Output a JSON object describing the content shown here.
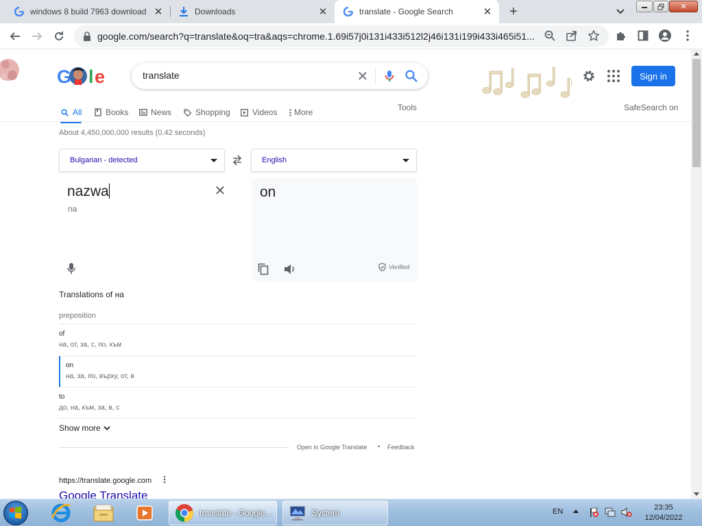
{
  "browser": {
    "tabs": [
      {
        "title": "windows 8 build 7963 download",
        "active": false
      },
      {
        "title": "Downloads",
        "active": false
      },
      {
        "title": "translate - Google Search",
        "active": true
      }
    ],
    "new_tab": "+",
    "url": "google.com/search?q=translate&oq=tra&aqs=chrome.1.69i57j0i131i433i512l2j46i131i199i433i465i51..."
  },
  "google": {
    "query": "translate",
    "sign_in": "Sign in",
    "tabs": [
      {
        "label": "All",
        "icon": "search-icon"
      },
      {
        "label": "Books",
        "icon": "book-icon"
      },
      {
        "label": "News",
        "icon": "news-icon"
      },
      {
        "label": "Shopping",
        "icon": "tag-icon"
      },
      {
        "label": "Videos",
        "icon": "play-icon"
      },
      {
        "label": "More",
        "icon": "more-vert-icon"
      }
    ],
    "tools": "Tools",
    "safesearch": "SafeSearch on",
    "results_count": "About 4,450,000,000 results (0.42 seconds)"
  },
  "translate": {
    "source_lang": "Bulgarian - detected",
    "target_lang": "English",
    "source_text": "nazwa",
    "source_translit": "na",
    "target_text": "on",
    "verified": "Verified",
    "translations_heading": "Translations of на",
    "part_of_speech": "preposition",
    "rows": [
      {
        "word": "of",
        "synonyms": "на, от, за, с, по, към"
      },
      {
        "word": "on",
        "synonyms": "на, за, по, върху, от, в"
      },
      {
        "word": "to",
        "synonyms": "до, на, към, за, в, с"
      }
    ],
    "show_more": "Show more",
    "open_in_translate": "Open in Google Translate",
    "dot": "•",
    "feedback": "Feedback"
  },
  "result": {
    "url": "https://translate.google.com",
    "title": "Google Translate"
  },
  "taskbar": {
    "tasks": [
      {
        "label": "translate - Google...",
        "active": true
      },
      {
        "label": "System",
        "active": false
      }
    ],
    "lang": "EN",
    "time": "23:35",
    "date": "12/04/2022"
  },
  "colors": {
    "accent": "#1a73e8",
    "link": "#1a0dab"
  }
}
